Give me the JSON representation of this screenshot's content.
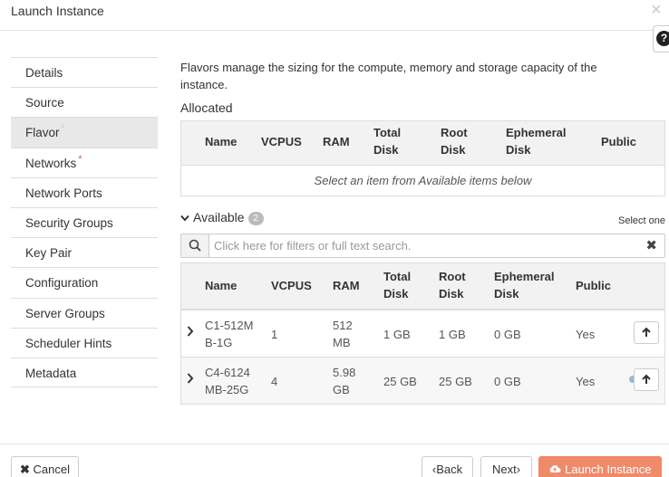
{
  "dialog": {
    "title": "Launch Instance",
    "close_glyph": "×",
    "help_glyph": "?"
  },
  "nav": [
    {
      "label": "Details",
      "star": ""
    },
    {
      "label": "Source",
      "star": ""
    },
    {
      "label": "Flavor",
      "star": "*"
    },
    {
      "label": "Networks",
      "star": "*"
    },
    {
      "label": "Network Ports",
      "star": ""
    },
    {
      "label": "Security Groups",
      "star": ""
    },
    {
      "label": "Key Pair",
      "star": ""
    },
    {
      "label": "Configuration",
      "star": ""
    },
    {
      "label": "Server Groups",
      "star": ""
    },
    {
      "label": "Scheduler Hints",
      "star": ""
    },
    {
      "label": "Metadata",
      "star": ""
    }
  ],
  "flavor": {
    "description": "Flavors manage the sizing for the compute, memory and storage capacity of the instance.",
    "allocated_label": "Allocated",
    "available_label": "Available",
    "available_count": "2",
    "select_one": "Select one",
    "empty_message": "Select an item from Available items below",
    "search_placeholder": "Click here for filters or full text search.",
    "columns": {
      "name": "Name",
      "vcpus": "VCPUS",
      "ram": "RAM",
      "total_disk": "Total Disk",
      "root_disk": "Root Disk",
      "ephemeral_disk": "Ephemeral Disk",
      "public": "Public"
    },
    "rows": [
      {
        "name": "C1-512MB-1G",
        "vcpus": "1",
        "ram": "512 MB",
        "total_disk": "1 GB",
        "root_disk": "1 GB",
        "ephemeral": "0 GB",
        "public": "Yes"
      },
      {
        "name": "C4-6124MB-25G",
        "vcpus": "4",
        "ram": "5.98 GB",
        "total_disk": "25 GB",
        "root_disk": "25 GB",
        "ephemeral": "0 GB",
        "public": "Yes"
      }
    ]
  },
  "footer": {
    "cancel": "Cancel",
    "back": "Back",
    "next": "Next",
    "launch": "Launch Instance"
  },
  "colors": {
    "primary": "#ef8a6a",
    "required_star": "#d9534f"
  }
}
